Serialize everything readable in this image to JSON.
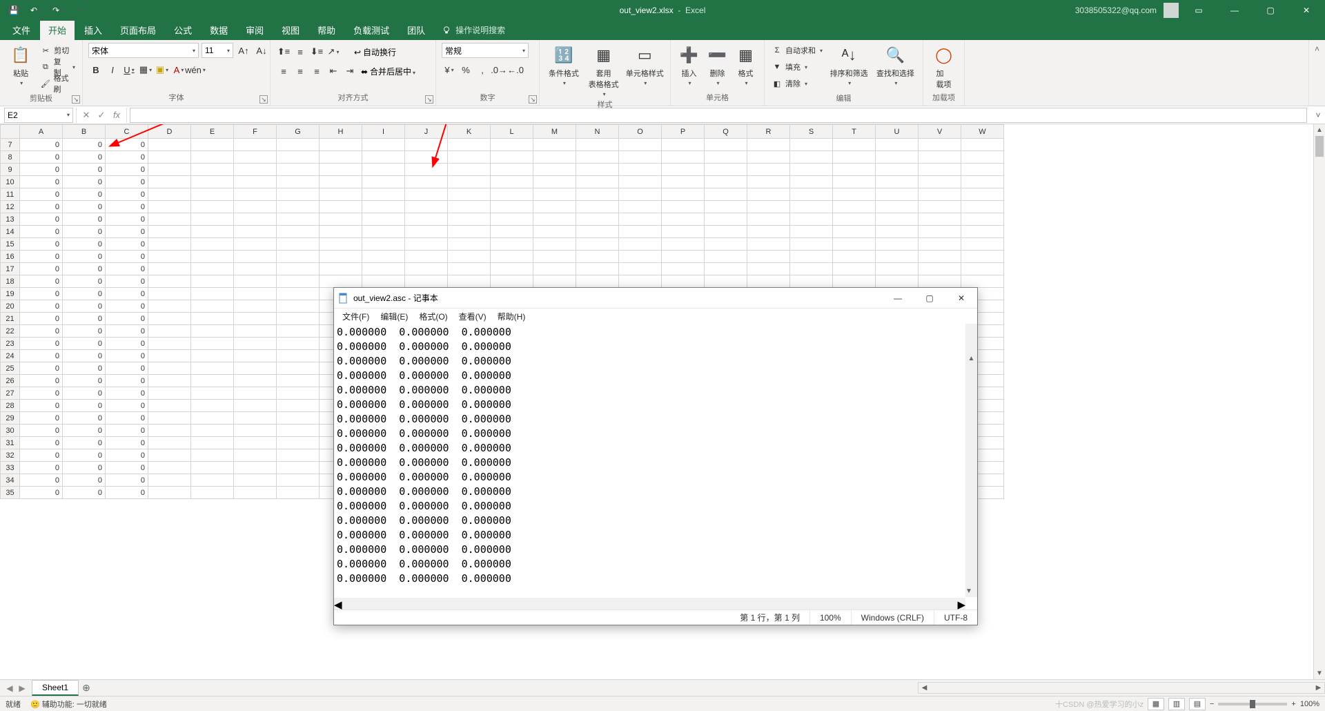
{
  "title": {
    "filename": "out_view2.xlsx",
    "app": "Excel"
  },
  "account": "3038505322@qq.com",
  "tabs": [
    "文件",
    "开始",
    "插入",
    "页面布局",
    "公式",
    "数据",
    "审阅",
    "视图",
    "帮助",
    "负载测试",
    "团队"
  ],
  "activeTab": "开始",
  "tellMe": "操作说明搜索",
  "ribbon": {
    "clipboard": {
      "label": "剪贴板",
      "paste": "粘贴",
      "cut": "剪切",
      "copy": "复制",
      "painter": "格式刷"
    },
    "font": {
      "label": "字体",
      "name": "宋体",
      "size": "11"
    },
    "alignment": {
      "label": "对齐方式",
      "wrap": "自动换行",
      "merge": "合并后居中"
    },
    "number": {
      "label": "数字",
      "format": "常规"
    },
    "styles": {
      "label": "样式",
      "cond": "条件格式",
      "table": "套用\n表格格式",
      "cell": "单元格样式"
    },
    "cells": {
      "label": "单元格",
      "insert": "插入",
      "delete": "删除",
      "format": "格式"
    },
    "editing": {
      "label": "编辑",
      "sum": "自动求和",
      "fill": "填充",
      "clear": "清除",
      "sort": "排序和筛选",
      "find": "查找和选择"
    },
    "addin": {
      "label": "加载项",
      "btn": "加\n载项"
    }
  },
  "nameBox": "E2",
  "colHeaders": [
    "A",
    "B",
    "C",
    "D",
    "E",
    "F",
    "G",
    "H",
    "I",
    "J",
    "K",
    "L",
    "M",
    "N",
    "O",
    "P",
    "Q",
    "R",
    "S",
    "T",
    "U",
    "V",
    "W"
  ],
  "rowStart": 7,
  "rowEnd": 35,
  "cellValue": "0",
  "sheetTab": "Sheet1",
  "status": {
    "ready": "就绪",
    "acc": "辅助功能: 一切就绪",
    "zoom": "100%",
    "watermark": "十CSDN @热爱学习的小z"
  },
  "notepad": {
    "title": "out_view2.asc - 记事本",
    "menus": [
      "文件(F)",
      "编辑(E)",
      "格式(O)",
      "查看(V)",
      "帮助(H)"
    ],
    "line": "0.000000  0.000000  0.000000",
    "lines": 18,
    "status": {
      "pos": "第 1 行，第 1 列",
      "zoom": "100%",
      "eol": "Windows (CRLF)",
      "enc": "UTF-8"
    }
  }
}
